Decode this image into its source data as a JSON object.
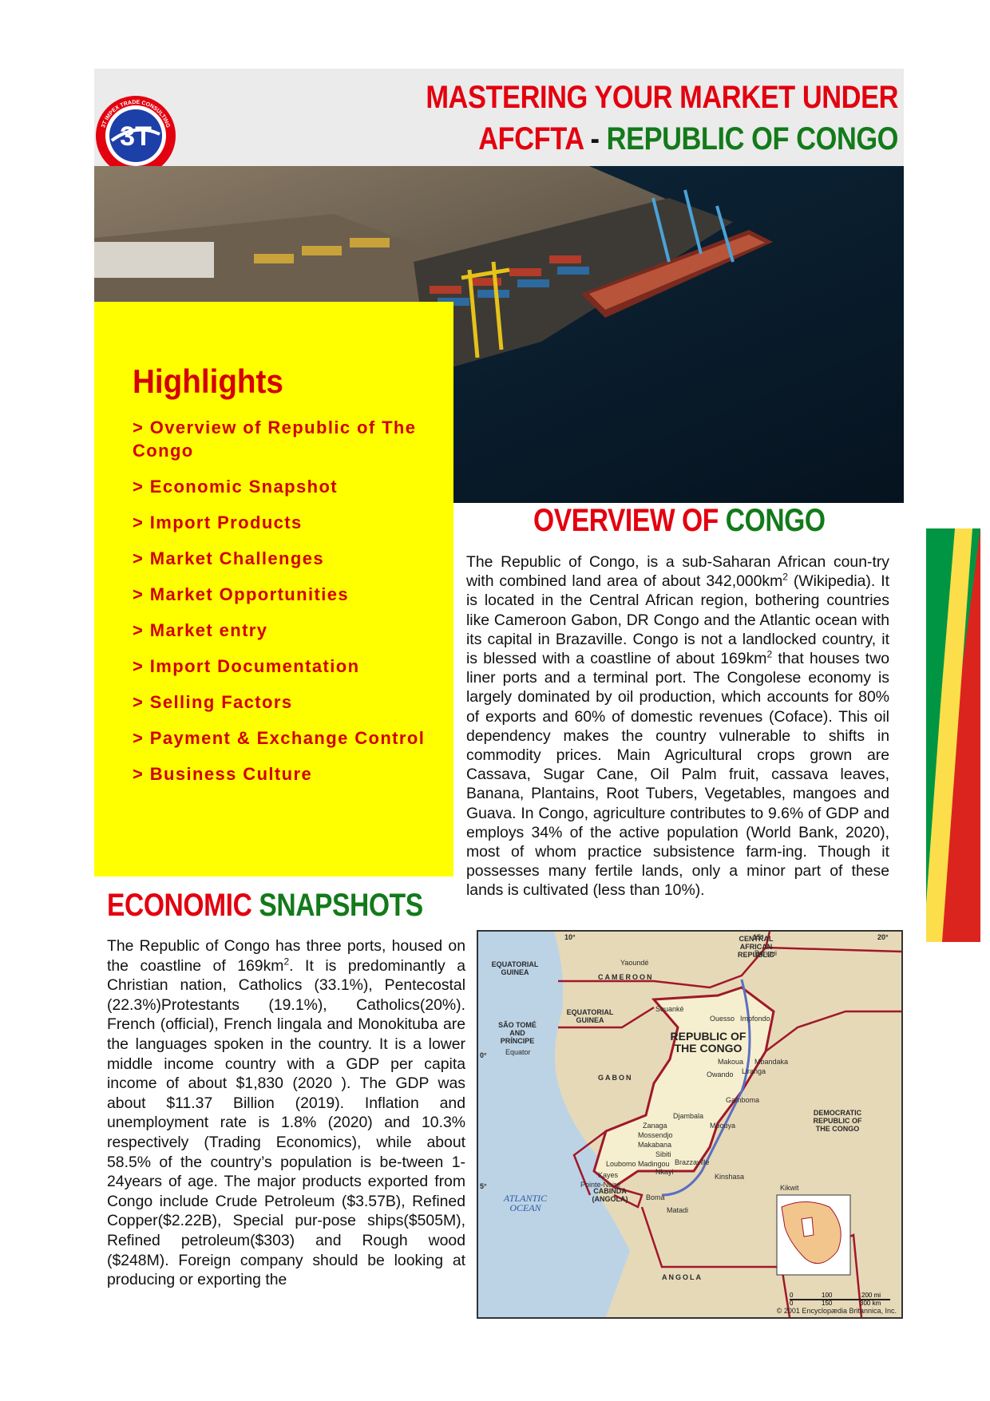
{
  "header": {
    "title_line1": "MASTERING YOUR MARKET UNDER",
    "title_line2_part1": "AFCFTA",
    "title_line2_sep": " - ",
    "title_line2_part2": "REPUBLIC OF CONGO",
    "logo_text": "3T IMPEX TRADE CONSULTING",
    "logo_mark": "3T"
  },
  "highlights": {
    "title": "Highlights",
    "items": [
      "> Overview of Republic of The Congo",
      "> Economic Snapshot",
      "> Import Products",
      "> Market Challenges",
      "> Market Opportunities",
      "> Market entry",
      "> Import Documentation",
      "> Selling Factors",
      "> Payment & Exchange Control",
      "> Business Culture"
    ]
  },
  "overview": {
    "heading_part1": "OVERVIEW OF ",
    "heading_part2": "CONGO",
    "p1_a": "The Republic of Congo, is a sub-Saharan African coun-try with combined land area of about 342,000km",
    "p1_sup": "2",
    "p1_b": " (Wikipedia). It is located in the Central African region, bothering countries like  Cameroon Gabon, DR Congo and the Atlantic ocean with its capital in Brazaville. Congo is not a landlocked country, it is blessed with a coastline of about 169km",
    "p1_sup2": "2",
    "p1_c": " that houses two liner ports and a terminal port. The Congolese economy is largely dominated by oil production, which accounts for 80% of exports and 60% of domestic revenues (Coface). This oil dependency makes the country vulnerable to shifts in commodity prices. Main Agricultural crops grown are Cassava, Sugar Cane, Oil Palm fruit, cassava leaves, Banana, Plantains, Root Tubers, Vegetables, mangoes and Guava. In Congo, agriculture contributes to 9.6% of GDP and employs 34% of the active population (World Bank, 2020), most of whom practice subsistence farm-ing. Though it possesses many fertile lands, only a minor part of these lands is cultivated (less than 10%)."
  },
  "economic": {
    "heading_part1": "ECONOMIC ",
    "heading_part2": "SNAPSHOTS",
    "p_a": "The Republic of Congo has three ports, housed on the coastline of 169km",
    "p_sup": "2",
    "p_b": ". It is predominantly a Christian nation, Catholics (33.1%), Pentecostal (22.3%)Protestants (19.1%), Catholics(20%). French (official), French lingala and Monokituba are the languages spoken in the country. It is a lower middle income country with a GDP per capita income of about $1,830 (2020 ). The GDP was about $11.37 Billion (2019). Inflation and unemployment rate is 1.8% (2020) and 10.3% respectively (Trading Economics), while about 58.5% of the country’s population is be-tween 1-24years of age.   The major products exported from Congo include Crude Petroleum ($3.57B), Refined Copper($2.22B), Special pur-pose ships($505M), Refined petroleum($303) and Rough wood ($248M). Foreign company should be looking at producing or exporting the"
  },
  "map": {
    "labels": {
      "eq_guinea_top": "EQUATORIAL GUINEA",
      "cameroon": "CAMEROON",
      "car": "CENTRAL AFRICAN REPUBLIC",
      "eq_guinea": "EQUATORIAL GUINEA",
      "sao_tome": "SÃO TOMÉ AND PRÍNCIPE",
      "equator": "Equator",
      "gabon": "GABON",
      "republic": "REPUBLIC OF THE CONGO",
      "drc": "DEMOCRATIC REPUBLIC OF THE CONGO",
      "atlantic": "ATLANTIC OCEAN",
      "cabinda": "CABINDA (ANGOLA)",
      "angola": "ANGOLA",
      "yaounde": "Yaoundé",
      "bangui": "Bangui",
      "souanke": "Souanké",
      "ouesso": "Ouesso",
      "impfondo": "Impfondo",
      "makoua": "Makoua",
      "mbandaka": "Mbandaka",
      "owando": "Owando",
      "liranga": "Liranga",
      "gamboma": "Gamboma",
      "djambala": "Djambala",
      "zanaga": "Zanaga",
      "mpouya": "Mpouya",
      "mossendjo": "Mossendjo",
      "makabana": "Makabana",
      "sibiti": "Sibiti",
      "madingou": "Madingou",
      "brazzaville": "Brazzaville",
      "loubomo": "Loubomo",
      "nkayi": "Nkayi",
      "kayes": "Kayes",
      "pointe_noire": "Pointe-Noire",
      "kinshasa": "Kinshasa",
      "kikwit": "Kikwit",
      "boma": "Boma",
      "matadi": "Matadi",
      "lon10": "10°",
      "lon15": "15°",
      "lon20": "20°",
      "lat0": "0°",
      "lat5": "5°"
    },
    "scale": {
      "mi0": "0",
      "mi100": "100",
      "mi200": "200 mi",
      "km0": "0",
      "km150": "150",
      "km300": "300 km"
    },
    "credit": "© 2001 Encyclopædia Britannica, Inc."
  },
  "colors": {
    "title_red": "#e3000f",
    "title_green": "#137a1a",
    "highlight_bg": "#ffff00",
    "highlight_text": "#d00000",
    "flag_green": "#009543",
    "flag_yellow": "#fbde4a",
    "flag_red": "#dc241f"
  }
}
